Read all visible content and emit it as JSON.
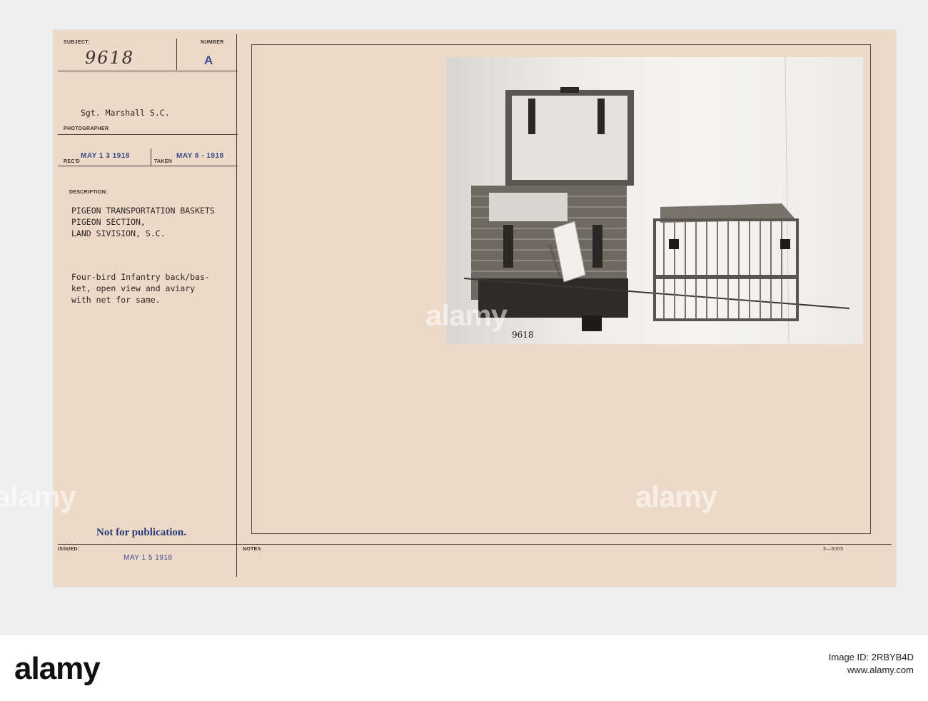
{
  "record": {
    "subject_label": "SUBJECT:",
    "subject_value": "9618",
    "number_label": "NUMBER",
    "number_value": "A",
    "photographer": "Sgt. Marshall S.C.",
    "photographer_label": "PHOTOGRAPHER",
    "received_label": "REC'D",
    "received_value": "MAY 1 3 1918",
    "taken_label": "TAKEN",
    "taken_value": "MAY 8 - 1918",
    "description_label": "DESCRIPTION:",
    "description_lines": [
      "PIGEON TRANSPORTATION BASKETS",
      "PIGEON SECTION,",
      "LAND SIVISION, S.C."
    ],
    "caption_lines": [
      "Four-bird Infantry back/bas-",
      "ket, open view and aviary",
      "with net for same."
    ],
    "not_for_publication": "Not for publication.",
    "issued_label": "ISSUED:",
    "issued_value": "MAY 1 5 1918",
    "notes_label": "NOTES",
    "form_number": "3—5005"
  },
  "photo": {
    "handwritten_number": "9618",
    "tag_text": "Infantry basket"
  },
  "watermark": {
    "brand": "alamy",
    "image_id_label": "Image ID: 2RBYB4D",
    "site": "www.alamy.com"
  },
  "colors": {
    "card": "#edd9c8",
    "stamp": "#3b4a8c"
  }
}
